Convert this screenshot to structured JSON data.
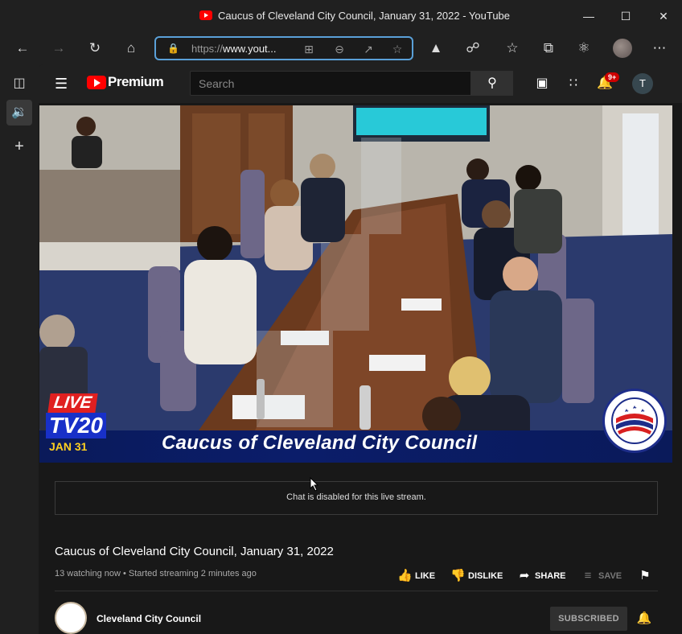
{
  "window": {
    "title": "Caucus of Cleveland City Council, January 31, 2022 - YouTube",
    "minimize_icon": "minimize-icon",
    "maximize_icon": "maximize-icon",
    "close_icon": "close-icon"
  },
  "toolbar": {
    "url_scheme": "https://",
    "url_host": "www.yout...",
    "icons": [
      "back-icon",
      "forward-icon",
      "refresh-icon",
      "home-icon",
      "lock-icon",
      "split-screen-icon",
      "zoom-out-icon",
      "share-icon",
      "favorite-add-icon",
      "browser-essentials-icon",
      "extensions-icon",
      "favorites-icon",
      "collections-icon",
      "copilot-icon",
      "profile-avatar",
      "more-icon"
    ]
  },
  "sidebar": {
    "icons": [
      "tab-actions-icon",
      "audio-icon",
      "new-tab-icon"
    ]
  },
  "youtube": {
    "logo_text": "Premium",
    "search_placeholder": "Search",
    "notification_count": "9+",
    "user_initial": "T"
  },
  "video": {
    "overlay_title": "Caucus of Cleveland City Council",
    "live_label": "LIVE",
    "channel_label": "TV20",
    "date_label": "JAN 31"
  },
  "chat": {
    "message": "Chat is disabled for this live stream."
  },
  "details": {
    "title": "Caucus of Cleveland City Council, January 31, 2022",
    "meta": "13 watching now • Started streaming 2 minutes ago",
    "like": "LIKE",
    "dislike": "DISLIKE",
    "share": "SHARE",
    "save": "SAVE"
  },
  "channel": {
    "name": "Cleveland City Council",
    "subscribe_label": "SUBSCRIBED"
  },
  "colors": {
    "accent": "#5aa0d8",
    "youtube_red": "#ff0000",
    "lower_third": "#0b1d6a"
  }
}
